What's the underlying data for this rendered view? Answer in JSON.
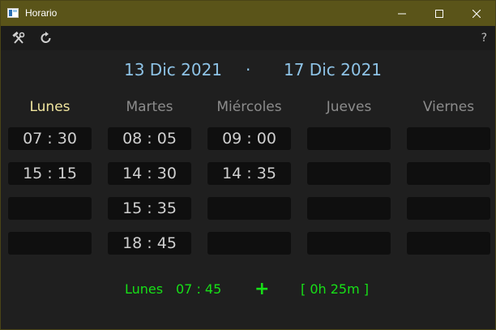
{
  "window": {
    "title": "Horario",
    "accent_color": "#5a5419"
  },
  "toolbar": {
    "tools_icon": "hammer-wrench-icon",
    "refresh_icon": "refresh-icon",
    "help_label": "?"
  },
  "date_range": {
    "start": "13 Dic 2021",
    "separator": "·",
    "end": "17 Dic 2021"
  },
  "days": [
    {
      "label": "Lunes",
      "today": true,
      "slots": [
        "07 : 30",
        "15 : 15",
        "",
        ""
      ]
    },
    {
      "label": "Martes",
      "today": false,
      "slots": [
        "08 : 05",
        "14 : 30",
        "15 : 35",
        "18 : 45"
      ]
    },
    {
      "label": "Miércoles",
      "today": false,
      "slots": [
        "09 : 00",
        "14 : 35",
        "",
        ""
      ]
    },
    {
      "label": "Jueves",
      "today": false,
      "slots": [
        "",
        "",
        "",
        ""
      ]
    },
    {
      "label": "Viernes",
      "today": false,
      "slots": [
        "",
        "",
        "",
        ""
      ]
    }
  ],
  "footer": {
    "day": "Lunes",
    "time": "07 : 45",
    "plus": "+",
    "difference": "[  0h  25m  ]",
    "color": "#17e017"
  }
}
